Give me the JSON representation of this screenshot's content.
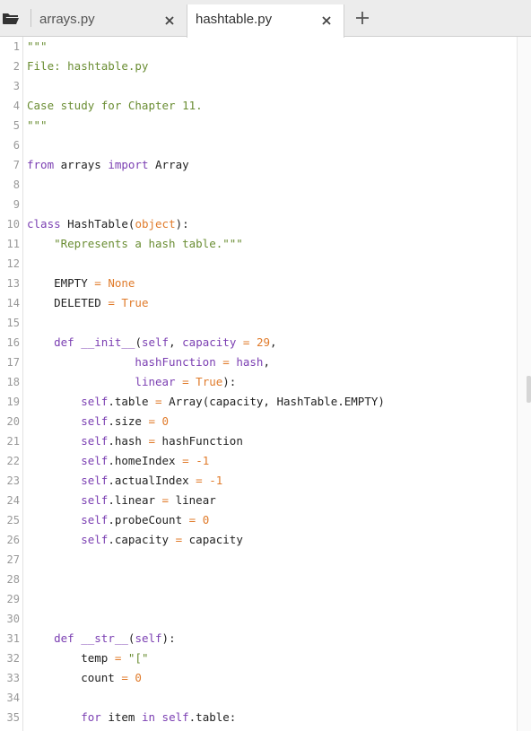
{
  "tabs": [
    {
      "label": "arrays.py",
      "active": false
    },
    {
      "label": "hashtable.py",
      "active": true
    }
  ],
  "icons": {
    "folder": "folder-open-icon",
    "close": "close-icon",
    "new_tab": "plus-icon"
  },
  "colors": {
    "keyword": "#7b3fb2",
    "string": "#6a8d33",
    "number": "#e07b2b",
    "line_number": "#999999",
    "tabbar_bg": "#ececec"
  },
  "lines": [
    {
      "n": "1",
      "tokens": [
        {
          "t": "\"\"\"",
          "c": "s"
        }
      ]
    },
    {
      "n": "2",
      "tokens": [
        {
          "t": "File: hashtable.py",
          "c": "s"
        }
      ]
    },
    {
      "n": "3",
      "tokens": []
    },
    {
      "n": "4",
      "tokens": [
        {
          "t": "Case study for Chapter 11.",
          "c": "s"
        }
      ]
    },
    {
      "n": "5",
      "tokens": [
        {
          "t": "\"\"\"",
          "c": "s"
        }
      ]
    },
    {
      "n": "6",
      "tokens": []
    },
    {
      "n": "7",
      "tokens": [
        {
          "t": "from",
          "c": "k"
        },
        {
          "t": " arrays ",
          "c": ""
        },
        {
          "t": "import",
          "c": "k"
        },
        {
          "t": " Array",
          "c": ""
        }
      ]
    },
    {
      "n": "8",
      "tokens": []
    },
    {
      "n": "9",
      "tokens": []
    },
    {
      "n": "10",
      "tokens": [
        {
          "t": "class",
          "c": "k"
        },
        {
          "t": " HashTable(",
          "c": ""
        },
        {
          "t": "object",
          "c": "n"
        },
        {
          "t": "):",
          "c": ""
        }
      ]
    },
    {
      "n": "11",
      "tokens": [
        {
          "t": "    ",
          "c": ""
        },
        {
          "t": "\"Represents a hash table.\"\"\"",
          "c": "s"
        }
      ]
    },
    {
      "n": "12",
      "tokens": []
    },
    {
      "n": "13",
      "tokens": [
        {
          "t": "    EMPTY ",
          "c": ""
        },
        {
          "t": "=",
          "c": "o"
        },
        {
          "t": " ",
          "c": ""
        },
        {
          "t": "None",
          "c": "n"
        }
      ]
    },
    {
      "n": "14",
      "tokens": [
        {
          "t": "    DELETED ",
          "c": ""
        },
        {
          "t": "=",
          "c": "o"
        },
        {
          "t": " ",
          "c": ""
        },
        {
          "t": "True",
          "c": "n"
        }
      ]
    },
    {
      "n": "15",
      "tokens": []
    },
    {
      "n": "16",
      "tokens": [
        {
          "t": "    ",
          "c": ""
        },
        {
          "t": "def",
          "c": "k"
        },
        {
          "t": " ",
          "c": ""
        },
        {
          "t": "__init__",
          "c": "fn"
        },
        {
          "t": "(",
          "c": ""
        },
        {
          "t": "self",
          "c": "k"
        },
        {
          "t": ", ",
          "c": ""
        },
        {
          "t": "capacity",
          "c": "k"
        },
        {
          "t": " ",
          "c": ""
        },
        {
          "t": "=",
          "c": "o"
        },
        {
          "t": " ",
          "c": ""
        },
        {
          "t": "29",
          "c": "n"
        },
        {
          "t": ",",
          "c": ""
        }
      ]
    },
    {
      "n": "17",
      "tokens": [
        {
          "t": "                ",
          "c": ""
        },
        {
          "t": "hashFunction",
          "c": "k"
        },
        {
          "t": " ",
          "c": ""
        },
        {
          "t": "=",
          "c": "o"
        },
        {
          "t": " ",
          "c": ""
        },
        {
          "t": "hash",
          "c": "k"
        },
        {
          "t": ",",
          "c": ""
        }
      ]
    },
    {
      "n": "18",
      "tokens": [
        {
          "t": "                ",
          "c": ""
        },
        {
          "t": "linear",
          "c": "k"
        },
        {
          "t": " ",
          "c": ""
        },
        {
          "t": "=",
          "c": "o"
        },
        {
          "t": " ",
          "c": ""
        },
        {
          "t": "True",
          "c": "n"
        },
        {
          "t": "):",
          "c": ""
        }
      ]
    },
    {
      "n": "19",
      "tokens": [
        {
          "t": "        ",
          "c": ""
        },
        {
          "t": "self",
          "c": "k"
        },
        {
          "t": ".table ",
          "c": ""
        },
        {
          "t": "=",
          "c": "o"
        },
        {
          "t": " Array(capacity, HashTable.EMPTY)",
          "c": ""
        }
      ]
    },
    {
      "n": "20",
      "tokens": [
        {
          "t": "        ",
          "c": ""
        },
        {
          "t": "self",
          "c": "k"
        },
        {
          "t": ".size ",
          "c": ""
        },
        {
          "t": "=",
          "c": "o"
        },
        {
          "t": " ",
          "c": ""
        },
        {
          "t": "0",
          "c": "n"
        }
      ]
    },
    {
      "n": "21",
      "tokens": [
        {
          "t": "        ",
          "c": ""
        },
        {
          "t": "self",
          "c": "k"
        },
        {
          "t": ".hash ",
          "c": ""
        },
        {
          "t": "=",
          "c": "o"
        },
        {
          "t": " hashFunction",
          "c": ""
        }
      ]
    },
    {
      "n": "22",
      "tokens": [
        {
          "t": "        ",
          "c": ""
        },
        {
          "t": "self",
          "c": "k"
        },
        {
          "t": ".homeIndex ",
          "c": ""
        },
        {
          "t": "=",
          "c": "o"
        },
        {
          "t": " ",
          "c": ""
        },
        {
          "t": "-1",
          "c": "n"
        }
      ]
    },
    {
      "n": "23",
      "tokens": [
        {
          "t": "        ",
          "c": ""
        },
        {
          "t": "self",
          "c": "k"
        },
        {
          "t": ".actualIndex ",
          "c": ""
        },
        {
          "t": "=",
          "c": "o"
        },
        {
          "t": " ",
          "c": ""
        },
        {
          "t": "-1",
          "c": "n"
        }
      ]
    },
    {
      "n": "24",
      "tokens": [
        {
          "t": "        ",
          "c": ""
        },
        {
          "t": "self",
          "c": "k"
        },
        {
          "t": ".linear ",
          "c": ""
        },
        {
          "t": "=",
          "c": "o"
        },
        {
          "t": " linear",
          "c": ""
        }
      ]
    },
    {
      "n": "25",
      "tokens": [
        {
          "t": "        ",
          "c": ""
        },
        {
          "t": "self",
          "c": "k"
        },
        {
          "t": ".probeCount ",
          "c": ""
        },
        {
          "t": "=",
          "c": "o"
        },
        {
          "t": " ",
          "c": ""
        },
        {
          "t": "0",
          "c": "n"
        }
      ]
    },
    {
      "n": "26",
      "tokens": [
        {
          "t": "        ",
          "c": ""
        },
        {
          "t": "self",
          "c": "k"
        },
        {
          "t": ".capacity ",
          "c": ""
        },
        {
          "t": "=",
          "c": "o"
        },
        {
          "t": " capacity",
          "c": ""
        }
      ]
    },
    {
      "n": "27",
      "tokens": []
    },
    {
      "n": "28",
      "tokens": []
    },
    {
      "n": "29",
      "tokens": []
    },
    {
      "n": "30",
      "tokens": []
    },
    {
      "n": "31",
      "tokens": [
        {
          "t": "    ",
          "c": ""
        },
        {
          "t": "def",
          "c": "k"
        },
        {
          "t": " ",
          "c": ""
        },
        {
          "t": "__str__",
          "c": "fn"
        },
        {
          "t": "(",
          "c": ""
        },
        {
          "t": "self",
          "c": "k"
        },
        {
          "t": "):",
          "c": ""
        }
      ]
    },
    {
      "n": "32",
      "tokens": [
        {
          "t": "        temp ",
          "c": ""
        },
        {
          "t": "=",
          "c": "o"
        },
        {
          "t": " ",
          "c": ""
        },
        {
          "t": "\"[\"",
          "c": "s"
        }
      ]
    },
    {
      "n": "33",
      "tokens": [
        {
          "t": "        count ",
          "c": ""
        },
        {
          "t": "=",
          "c": "o"
        },
        {
          "t": " ",
          "c": ""
        },
        {
          "t": "0",
          "c": "n"
        }
      ]
    },
    {
      "n": "34",
      "tokens": []
    },
    {
      "n": "35",
      "tokens": [
        {
          "t": "        ",
          "c": ""
        },
        {
          "t": "for",
          "c": "k"
        },
        {
          "t": " item ",
          "c": ""
        },
        {
          "t": "in",
          "c": "k"
        },
        {
          "t": " ",
          "c": ""
        },
        {
          "t": "self",
          "c": "k"
        },
        {
          "t": ".table:",
          "c": ""
        }
      ]
    }
  ]
}
